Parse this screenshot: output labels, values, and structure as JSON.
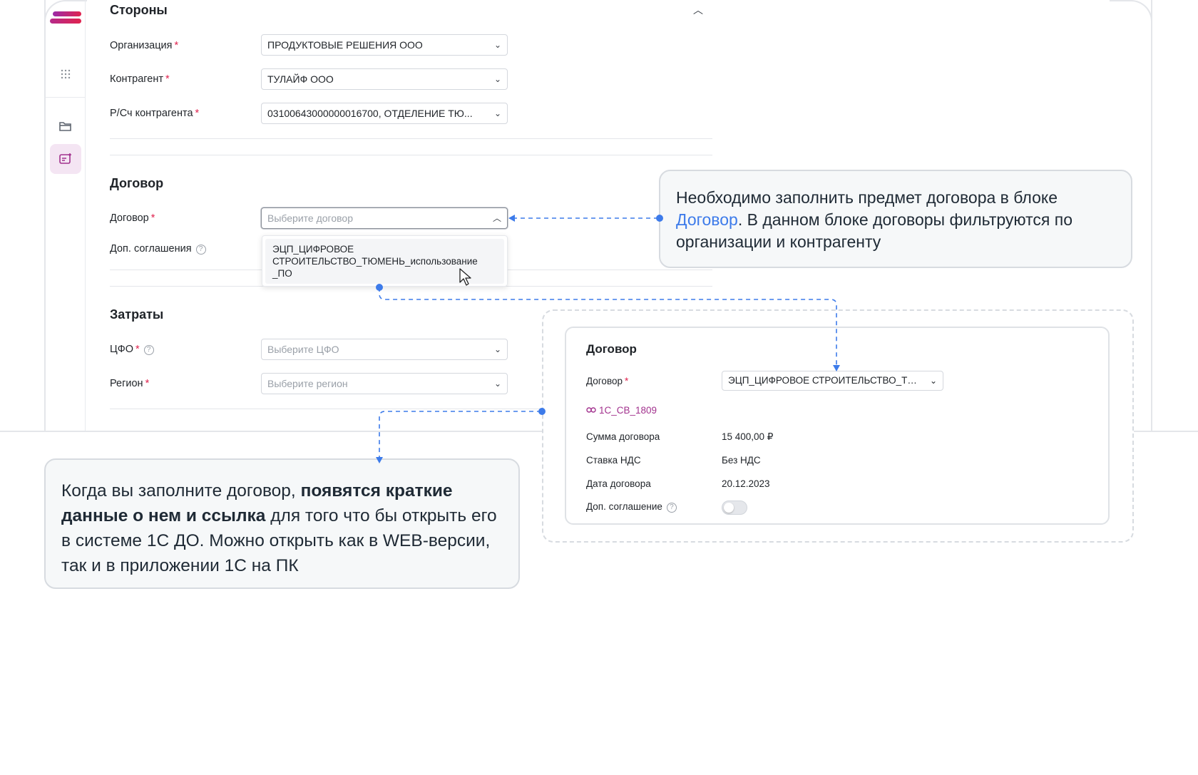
{
  "sections": {
    "parties": {
      "title": "Стороны",
      "fields": [
        {
          "label": "Организация",
          "value": "ПРОДУКТОВЫЕ РЕШЕНИЯ ООО"
        },
        {
          "label": "Контрагент",
          "value": "ТУЛАЙФ ООО"
        },
        {
          "label": "Р/Сч контрагента",
          "value": "03100643000000016700, ОТДЕЛЕНИЕ ТЮ..."
        }
      ]
    },
    "contract": {
      "title": "Договор",
      "contract_label": "Договор",
      "contract_placeholder": "Выберите договор",
      "addendum_label": "Доп. соглашения",
      "dropdown_option": "ЭЦП_ЦИФРОВОЕ СТРОИТЕЛЬСТВО_ТЮМЕНЬ_использование _ПО"
    },
    "costs": {
      "title": "Затраты",
      "cfo_label": "ЦФО",
      "cfo_placeholder": "Выберите ЦФО",
      "region_label": "Регион",
      "region_placeholder": "Выберите регион"
    }
  },
  "callout_top": {
    "text_before": "Необходимо заполнить предмет договора в блоке ",
    "link_text": "Договор",
    "text_after": ". В данном блоке договоры фильтруются по организации и контрагенту"
  },
  "callout_bottom": {
    "text_before": "Когда вы заполните договор, ",
    "bold_text": "появятся краткие данные о нем и ссылка",
    "text_after": " для того что бы открыть его в системе 1С ДО. Можно открыть как в WEB-версии, так и в приложении 1С на ПК"
  },
  "preview": {
    "title": "Договор",
    "contract_label": "Договор",
    "contract_value": "ЭЦП_ЦИФРОВОЕ СТРОИТЕЛЬСТВО_ТЮМ...",
    "link": "1С_СВ_1809",
    "rows": [
      {
        "label": "Сумма договора",
        "value": "15 400,00 ₽"
      },
      {
        "label": "Ставка НДС",
        "value": "Без НДС"
      },
      {
        "label": "Дата договора",
        "value": "20.12.2023"
      }
    ],
    "addendum_label": "Доп. соглашение",
    "addendum_toggle_on": false
  },
  "colors": {
    "accent_blue": "#3d7bea",
    "required": "#e0234e",
    "link_purple": "#a2328e"
  }
}
